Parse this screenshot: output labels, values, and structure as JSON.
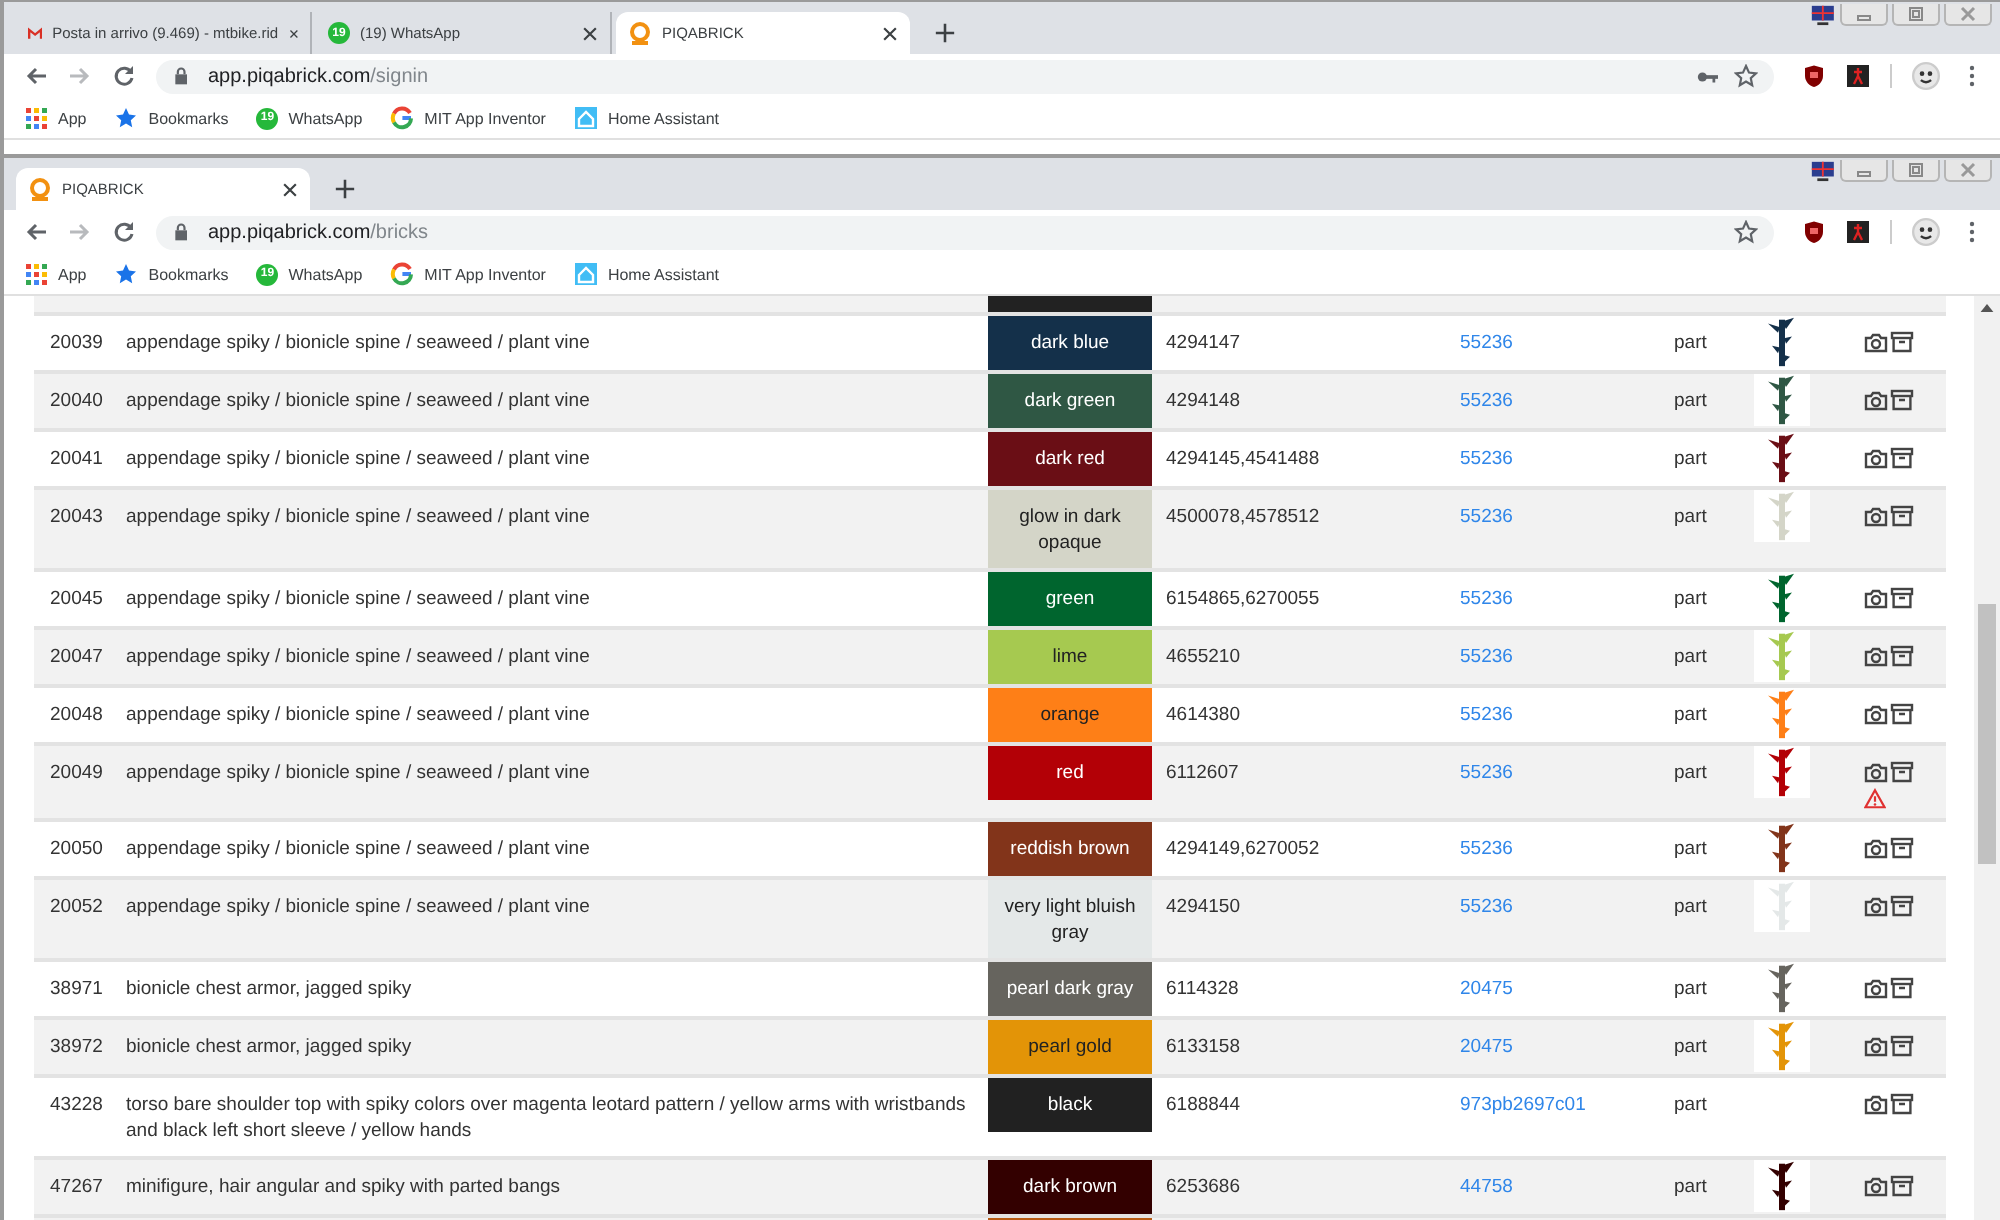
{
  "windows": [
    {
      "tabs": [
        {
          "kind": "mail",
          "title": "Posta in arrivo (9.469) - mtbike.rid",
          "selected": false
        },
        {
          "kind": "chat",
          "badge": "19",
          "title": "(19) WhatsApp",
          "selected": false
        },
        {
          "kind": "brick",
          "title": "PIQABRICK",
          "selected": true
        }
      ],
      "url": {
        "host": "app.piqabrick.com",
        "path": "/signin"
      },
      "password_icon": true,
      "bookmarks": [
        {
          "kind": "apps",
          "label": "App"
        },
        {
          "kind": "star",
          "label": "Bookmarks"
        },
        {
          "kind": "chat",
          "badge": "19",
          "label": "WhatsApp"
        },
        {
          "kind": "g",
          "label": "MIT App Inventor"
        },
        {
          "kind": "house",
          "label": "Home Assistant"
        }
      ]
    },
    {
      "tabs": [
        {
          "kind": "brick",
          "title": "PIQABRICK",
          "selected": true
        }
      ],
      "url": {
        "host": "app.piqabrick.com",
        "path": "/bricks"
      },
      "password_icon": false,
      "bookmarks": [
        {
          "kind": "apps",
          "label": "App"
        },
        {
          "kind": "star",
          "label": "Bookmarks"
        },
        {
          "kind": "chat",
          "badge": "19",
          "label": "WhatsApp"
        },
        {
          "kind": "g",
          "label": "MIT App Inventor"
        },
        {
          "kind": "house",
          "label": "Home Assistant"
        }
      ],
      "table": {
        "rows": [
          {
            "kind": "clipped",
            "color": "#222222"
          },
          {
            "kind": "item",
            "id": "20039",
            "name": "appendage spiky / bionicle spine / seaweed / plant vine",
            "color": "#14304a",
            "color_name": "dark blue",
            "element_ids": "4294147",
            "design": "55236",
            "type": "part",
            "warning": false
          },
          {
            "kind": "item",
            "id": "20040",
            "name": "appendage spiky / bionicle spine / seaweed / plant vine",
            "color": "#2f5744",
            "color_name": "dark green",
            "element_ids": "4294148",
            "design": "55236",
            "type": "part",
            "warning": false
          },
          {
            "kind": "item",
            "id": "20041",
            "name": "appendage spiky / bionicle spine / seaweed / plant vine",
            "color": "#6a0e15",
            "color_name": "dark red",
            "element_ids": "4294145,4541488",
            "design": "55236",
            "type": "part",
            "warning": false
          },
          {
            "kind": "item",
            "id": "20043",
            "name": "appendage spiky / bionicle spine / seaweed / plant vine",
            "color": "#d4d5c8",
            "color_name": "glow in dark opaque",
            "element_ids": "4500078,4578512",
            "design": "55236",
            "type": "part",
            "warning": false
          },
          {
            "kind": "item",
            "id": "20045",
            "name": "appendage spiky / bionicle spine / seaweed / plant vine",
            "color": "#00652e",
            "color_name": "green",
            "element_ids": "6154865,6270055",
            "design": "55236",
            "type": "part",
            "warning": false
          },
          {
            "kind": "item",
            "id": "20047",
            "name": "appendage spiky / bionicle spine / seaweed / plant vine",
            "color": "#a6c950",
            "color_name": "lime",
            "element_ids": "4655210",
            "design": "55236",
            "type": "part",
            "warning": false
          },
          {
            "kind": "item",
            "id": "20048",
            "name": "appendage spiky / bionicle spine / seaweed / plant vine",
            "color": "#fe7f17",
            "color_name": "orange",
            "element_ids": "4614380",
            "design": "55236",
            "type": "part",
            "warning": false
          },
          {
            "kind": "item",
            "id": "20049",
            "name": "appendage spiky / bionicle spine / seaweed / plant vine",
            "color": "#b30006",
            "color_name": "red",
            "element_ids": "6112607",
            "design": "55236",
            "type": "part",
            "warning": true
          },
          {
            "kind": "item",
            "id": "20050",
            "name": "appendage spiky / bionicle spine / seaweed / plant vine",
            "color": "#82341a",
            "color_name": "reddish brown",
            "element_ids": "4294149,6270052",
            "design": "55236",
            "type": "part",
            "warning": false
          },
          {
            "kind": "item",
            "id": "20052",
            "name": "appendage spiky / bionicle spine / seaweed / plant vine",
            "color": "#e4e8e8",
            "color_name": "very light bluish gray",
            "element_ids": "4294150",
            "design": "55236",
            "type": "part",
            "warning": false
          },
          {
            "kind": "item",
            "id": "38971",
            "name": "bionicle chest armor, jagged spiky",
            "color": "#66645e",
            "color_name": "pearl dark gray",
            "element_ids": "6114328",
            "design": "20475",
            "type": "part",
            "warning": false
          },
          {
            "kind": "item",
            "id": "38972",
            "name": "bionicle chest armor, jagged spiky",
            "color": "#e39407",
            "color_name": "pearl gold",
            "element_ids": "6133158",
            "design": "20475",
            "type": "part",
            "warning": false
          },
          {
            "kind": "item",
            "id": "43228",
            "name": "torso bare shoulder top with spiky colors over magenta leotard pattern / yellow arms with wristbands and black left short sleeve / yellow hands",
            "color": "#212121",
            "color_name": "black",
            "element_ids": "6188844",
            "design": "973pb2697c01",
            "type": "part",
            "warning": false
          },
          {
            "kind": "item",
            "id": "47267",
            "name": "minifigure, hair angular and spiky with parted bangs",
            "color": "#330000",
            "color_name": "dark brown",
            "element_ids": "6253686",
            "design": "44758",
            "type": "part",
            "warning": false
          },
          {
            "kind": "clipped",
            "color": "#b85b14"
          }
        ]
      }
    }
  ]
}
